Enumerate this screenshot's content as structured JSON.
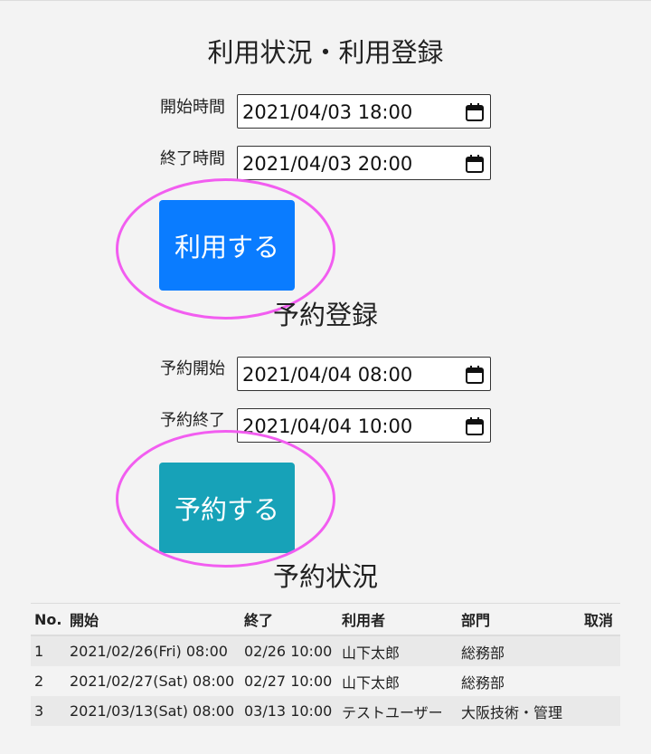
{
  "usage_section": {
    "title": "利用状況・利用登録",
    "start_label": "開始時間",
    "start_value": "2021/04/03 18:00",
    "end_label": "終了時間",
    "end_value": "2021/04/03 20:00",
    "submit_label": "利用する"
  },
  "reserve_section": {
    "title": "予約登録",
    "start_label": "予約開始",
    "start_value": "2021/04/04 08:00",
    "end_label": "予約終了",
    "end_value": "2021/04/04 10:00",
    "submit_label": "予約する"
  },
  "status_section": {
    "title": "予約状況",
    "columns": [
      "No.",
      "開始",
      "終了",
      "利用者",
      "部門",
      "取消"
    ],
    "rows": [
      {
        "no": "1",
        "start": "2021/02/26(Fri) 08:00",
        "end": "02/26 10:00",
        "user": "山下太郎",
        "dept": "総務部"
      },
      {
        "no": "2",
        "start": "2021/02/27(Sat) 08:00",
        "end": "02/27 10:00",
        "user": "山下太郎",
        "dept": "総務部"
      },
      {
        "no": "3",
        "start": "2021/03/13(Sat) 08:00",
        "end": "03/13 10:00",
        "user": "テストユーザー",
        "dept": "大阪技術・管理"
      }
    ]
  },
  "colors": {
    "primary_button": "#0a7cff",
    "info_button": "#17a2b8",
    "highlight_ring": "#f25df0"
  },
  "icons": {
    "datetime_picker": "calendar-icon"
  }
}
